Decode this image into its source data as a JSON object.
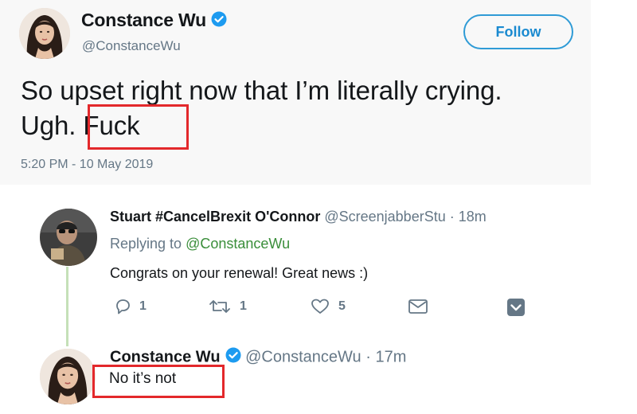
{
  "colors": {
    "link": "#1a8ad0",
    "mention_green": "#3a8e3a",
    "highlight_red": "#e3282b",
    "secondary_text": "#657786"
  },
  "main_tweet": {
    "author_name": "Constance Wu",
    "handle": "@ConstanceWu",
    "verified_icon": "verified-badge-icon",
    "follow_label": "Follow",
    "text_line1": "So upset right now that I’m literally crying.",
    "text_line2_prefix": "Ugh.",
    "text_line2_highlight": "Fuck",
    "timestamp": "5:20 PM - 10 May 2019"
  },
  "reply": {
    "author_name": "Stuart #CancelBrexit O'Connor",
    "handle": "@ScreenjabberStu",
    "separator": "·",
    "age": "18m",
    "replying_prefix": "Replying to",
    "replying_mention": "@ConstanceWu",
    "text": "Congrats on your renewal! Great news :)",
    "actions": {
      "reply_count": "1",
      "retweet_count": "1",
      "like_count": "5",
      "reply_icon": "reply-icon",
      "retweet_icon": "retweet-icon",
      "like_icon": "heart-icon",
      "dm_icon": "envelope-icon",
      "more_icon": "chevron-down-icon"
    }
  },
  "second_reply": {
    "author_name": "Constance Wu",
    "handle": "@ConstanceWu",
    "separator": "·",
    "age": "17m",
    "text": "No it’s not"
  }
}
